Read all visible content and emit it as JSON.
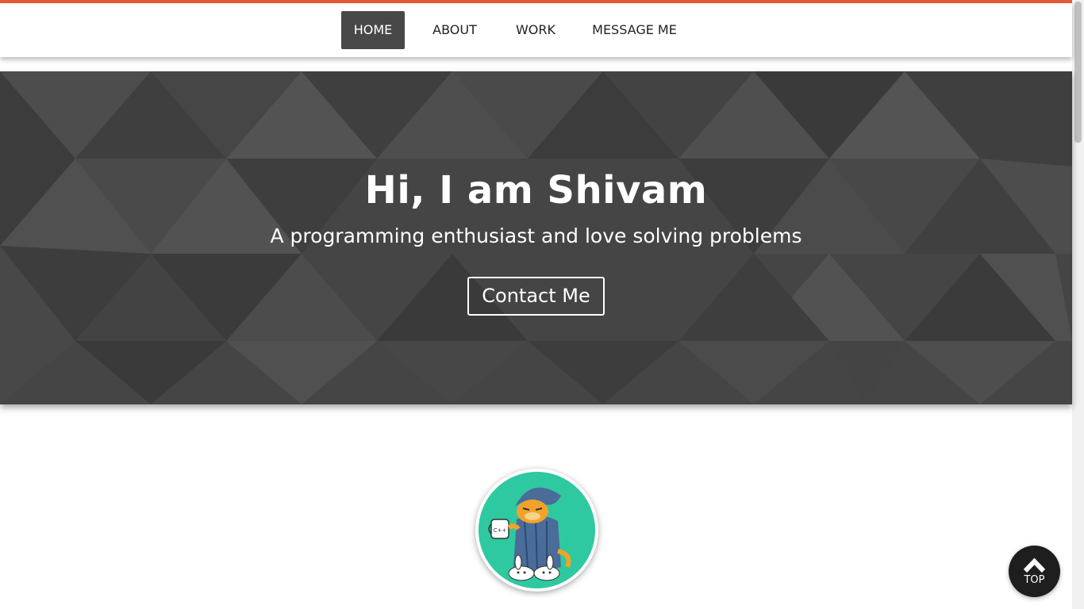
{
  "colors": {
    "accent": "#e8593a",
    "nav_active": "#484848",
    "hero_bg": "#454545",
    "avatar_bg": "#2ec9a0",
    "top_button": "#1e1e1e"
  },
  "nav": {
    "items": [
      {
        "label": "HOME",
        "active": true
      },
      {
        "label": "ABOUT",
        "active": false
      },
      {
        "label": "WORK",
        "active": false
      },
      {
        "label": "MESSAGE ME",
        "active": false
      }
    ]
  },
  "hero": {
    "title": "Hi, I am Shivam",
    "subtitle": "A programming enthusiast and love solving problems",
    "cta_label": "Contact Me"
  },
  "avatar": {
    "icon": "garfield-cartoon-avatar",
    "mug_text": "C++"
  },
  "back_to_top": {
    "label": "TOP",
    "icon": "chevron-up-icon"
  }
}
